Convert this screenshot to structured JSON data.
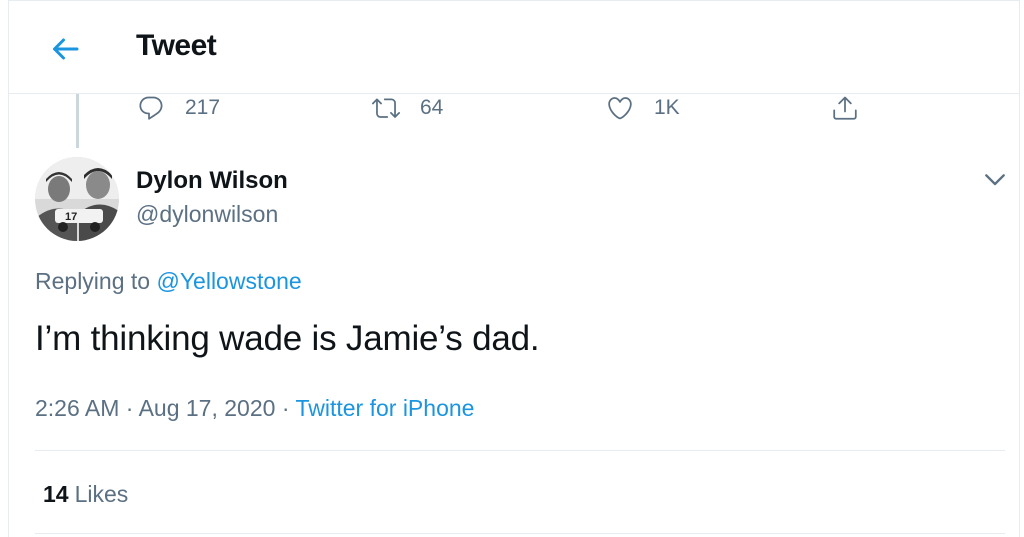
{
  "header": {
    "title": "Tweet"
  },
  "parent_tweet_actions": {
    "reply_count": "217",
    "retweet_count": "64",
    "like_count": "1K"
  },
  "tweet": {
    "author_name": "Dylon Wilson",
    "author_handle": "@dylonwilson",
    "replying_prefix": "Replying to",
    "replying_to": "@Yellowstone",
    "text": "I’m thinking wade is Jamie’s dad.",
    "time": "2:26 AM",
    "separator": "·",
    "date": "Aug 17, 2020",
    "source": "Twitter for iPhone",
    "likes_count": "14",
    "likes_label": "Likes"
  },
  "colors": {
    "accent": "#1b95e0",
    "secondary_text": "#5b7083",
    "divider": "#e6ecf0"
  },
  "icons": [
    "back-arrow-icon",
    "reply-icon",
    "retweet-icon",
    "like-icon",
    "share-icon",
    "chevron-down-icon"
  ]
}
